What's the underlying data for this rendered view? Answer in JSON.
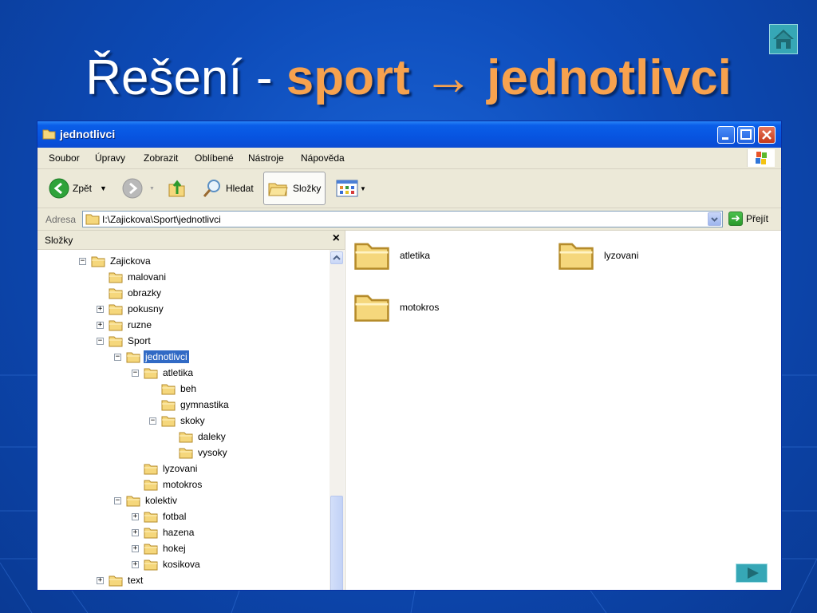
{
  "slide": {
    "title_prefix": "Řešení - ",
    "title_highlight": "sport → jednotlivci",
    "home_icon": "home-icon",
    "next_icon": "next-arrow-icon",
    "colors": {
      "background": "#0d4bb8",
      "accent": "#f7a24e",
      "nav_button": "#36a7b6"
    }
  },
  "window": {
    "title": "jednotlivci",
    "controls": [
      "minimize",
      "maximize",
      "close"
    ]
  },
  "menu": [
    "Soubor",
    "Úpravy",
    "Zobrazit",
    "Oblíbené",
    "Nástroje",
    "Nápověda"
  ],
  "toolbar": {
    "back_label": "Zpět",
    "search_label": "Hledat",
    "folders_label": "Složky"
  },
  "address": {
    "label": "Adresa",
    "value": "I:\\Zajickova\\Sport\\jednotlivci",
    "go_label": "Přejít"
  },
  "folders_pane": {
    "title": "Složky",
    "close": "×",
    "tree": [
      {
        "label": "Zajickova",
        "level": 0,
        "toggle": "−"
      },
      {
        "label": "malovani",
        "level": 1,
        "toggle": ""
      },
      {
        "label": "obrazky",
        "level": 1,
        "toggle": ""
      },
      {
        "label": "pokusny",
        "level": 1,
        "toggle": "+"
      },
      {
        "label": "ruzne",
        "level": 1,
        "toggle": "+"
      },
      {
        "label": "Sport",
        "level": 1,
        "toggle": "−"
      },
      {
        "label": "jednotlivci",
        "level": 2,
        "toggle": "−",
        "selected": true
      },
      {
        "label": "atletika",
        "level": 3,
        "toggle": "−"
      },
      {
        "label": "beh",
        "level": 4,
        "toggle": ""
      },
      {
        "label": "gymnastika",
        "level": 4,
        "toggle": ""
      },
      {
        "label": "skoky",
        "level": 4,
        "toggle": "−"
      },
      {
        "label": "daleky",
        "level": 5,
        "toggle": ""
      },
      {
        "label": "vysoky",
        "level": 5,
        "toggle": ""
      },
      {
        "label": "lyzovani",
        "level": 3,
        "toggle": ""
      },
      {
        "label": "motokros",
        "level": 3,
        "toggle": ""
      },
      {
        "label": "kolektiv",
        "level": 2,
        "toggle": "−"
      },
      {
        "label": "fotbal",
        "level": 3,
        "toggle": "+"
      },
      {
        "label": "hazena",
        "level": 3,
        "toggle": "+"
      },
      {
        "label": "hokej",
        "level": 3,
        "toggle": "+"
      },
      {
        "label": "kosikova",
        "level": 3,
        "toggle": "+"
      },
      {
        "label": "text",
        "level": 1,
        "toggle": "+"
      }
    ]
  },
  "content_items": [
    "atletika",
    "lyzovani",
    "motokros"
  ]
}
